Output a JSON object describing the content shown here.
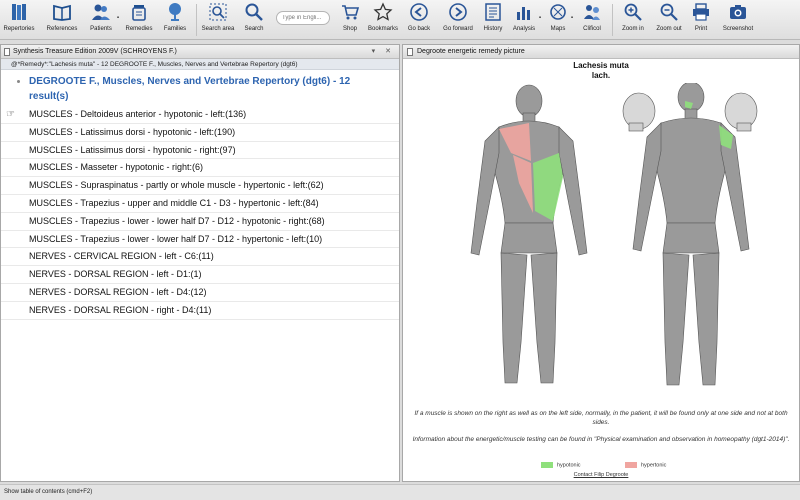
{
  "toolbar": {
    "items": [
      {
        "label": "Repertories",
        "icon": "repertory-books-icon"
      },
      {
        "label": "References",
        "icon": "open-book-icon"
      },
      {
        "label": "Patients",
        "icon": "patients-icon"
      },
      {
        "label": "Remedies",
        "icon": "remedy-jar-icon"
      },
      {
        "label": "Families",
        "icon": "family-tree-icon"
      },
      {
        "label": "Search area",
        "icon": "search-area-icon"
      },
      {
        "label": "Search",
        "icon": "magnifier-icon"
      },
      {
        "label": "Shop",
        "icon": "cart-icon"
      },
      {
        "label": "Bookmarks",
        "icon": "star-icon"
      },
      {
        "label": "Go back",
        "icon": "arrow-left-icon"
      },
      {
        "label": "Go forward",
        "icon": "arrow-right-icon"
      },
      {
        "label": "History",
        "icon": "history-icon"
      },
      {
        "label": "Analysis",
        "icon": "analysis-chart-icon"
      },
      {
        "label": "Maps",
        "icon": "maps-icon"
      },
      {
        "label": "Clificol",
        "icon": "clificol-icon"
      },
      {
        "label": "Zoom in",
        "icon": "zoom-in-icon"
      },
      {
        "label": "Zoom out",
        "icon": "zoom-out-icon"
      },
      {
        "label": "Print",
        "icon": "printer-icon"
      },
      {
        "label": "Screenshot",
        "icon": "camera-icon"
      }
    ],
    "search_placeholder": "Type in Engli..."
  },
  "left_pane": {
    "title": "Synthesis Treasure Edition 2009V (SCHROYENS F.)",
    "controls": "▾ ✕",
    "query": "@*Remedy*:\"Lachesis muta\" - 12  DEGROOTE F., Muscles, Nerves and Vertebrae Repertory (dgt6)",
    "result_title": "DEGROOTE F., Muscles, Nerves and Vertebrae Repertory (dgt6) - 12 result(s)",
    "rubrics": [
      "MUSCLES - Deltoideus anterior - hypotonic - left:(136)",
      "MUSCLES - Latissimus dorsi - hypotonic - left:(190)",
      "MUSCLES - Latissimus dorsi - hypotonic - right:(97)",
      "MUSCLES - Masseter - hypotonic - right:(6)",
      "MUSCLES - Supraspinatus - partly or whole muscle - hypertonic - left:(62)",
      "MUSCLES - Trapezius - upper and middle C1 - D3 - hypertonic - left:(84)",
      "MUSCLES - Trapezius - lower - lower half D7 - D12 - hypotonic - right:(68)",
      "MUSCLES - Trapezius - lower - lower half D7 - D12 - hypertonic - left:(10)",
      "NERVES - CERVICAL REGION - left - C6:(11)",
      "NERVES - DORSAL REGION - left - D1:(1)",
      "NERVES - DORSAL REGION - left - D4:(12)",
      "NERVES - DORSAL REGION - right - D4:(11)"
    ]
  },
  "right_pane": {
    "title": "Degroote energetic remedy picture",
    "remedy_name": "Lachesis muta",
    "remedy_abbrev": "lach.",
    "note1": "If a muscle is shown on the right as well as on the left side, normally, in the patient, it will be found only at one side and not at both sides.",
    "note2": "Information about the energetic/muscle testing can be found in \"Physical examination and observation in homeopathy (dgt1-2014)\".",
    "legend": {
      "hypotonic": "hypotonic",
      "hypertonic": "hypertonic"
    },
    "contact": "Contact Filip Degroote",
    "colors": {
      "hypotonic": "#8fe07c",
      "hypertonic": "#f0a5a0"
    }
  },
  "status_bar": {
    "text": "Show table of contents (cmd+F2)"
  }
}
